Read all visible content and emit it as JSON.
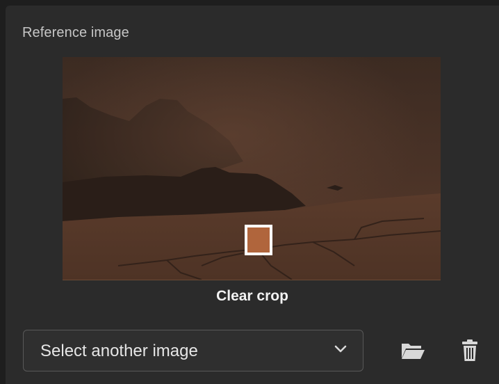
{
  "reference": {
    "title": "Reference image",
    "clear_crop_label": "Clear crop"
  },
  "controls": {
    "select_value": "Select another image",
    "chevron_icon": "chevron-down",
    "folder_icon": "folder-open",
    "trash_icon": "trash-can"
  },
  "colors": {
    "panel_bg": "#2b2b2b",
    "accent_text": "#f2f2f2",
    "crop_border": "#ffffff"
  }
}
